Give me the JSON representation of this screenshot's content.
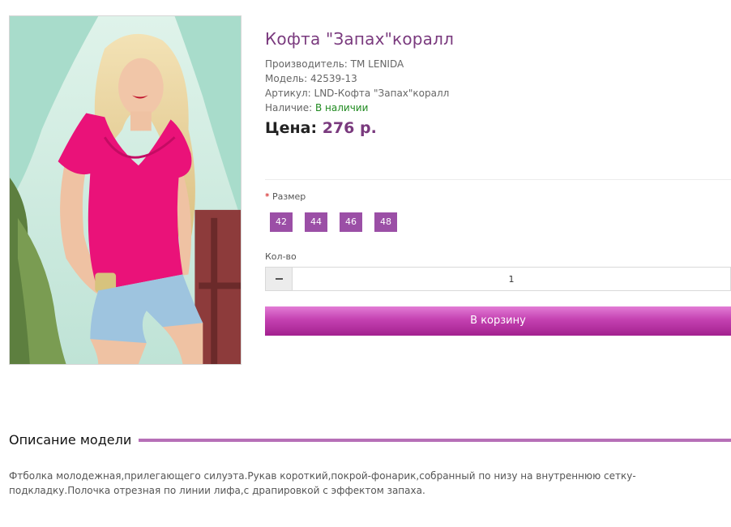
{
  "product": {
    "title": "Кофта \"Запах\"коралл",
    "manufacturer_label": "Производитель:",
    "manufacturer": "TM LENIDA",
    "model_label": "Модель:",
    "model": "42539-13",
    "sku_label": "Артикул:",
    "sku": "LND-Кофта \"Запах\"коралл",
    "availability_label": "Наличие:",
    "availability": "В наличии",
    "price_label": "Цена:",
    "price": "276 р."
  },
  "options": {
    "size_required_mark": "*",
    "size_label": "Размер",
    "sizes": [
      "42",
      "44",
      "46",
      "48"
    ],
    "qty_label": "Кол-во",
    "qty_value": "1",
    "add_to_cart": "В корзину"
  },
  "description": {
    "heading": "Описание модели",
    "text": "Фтболка молодежная,прилегающего силуэта.Рукав короткий,покрой-фонарик,собранный по низу на внутреннюю сетку-подкладку.Полочка отрезная по линии лифа,с драпировкой с эффектом запаха."
  },
  "colors": {
    "accent": "#9b4fa6",
    "title": "#7a3a7e",
    "in_stock": "#1f8a1f",
    "cart_button": "#c441b1"
  },
  "icons": {
    "qty_decrease": "minus-icon"
  }
}
